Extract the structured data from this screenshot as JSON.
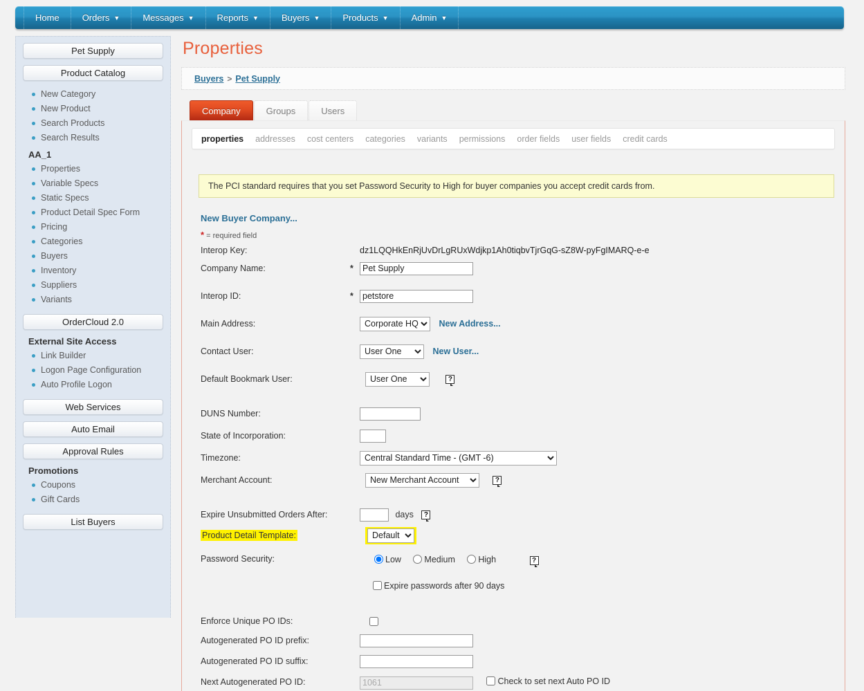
{
  "topnav": {
    "items": [
      {
        "label": "Home",
        "has_caret": false
      },
      {
        "label": "Orders",
        "has_caret": true
      },
      {
        "label": "Messages",
        "has_caret": true
      },
      {
        "label": "Reports",
        "has_caret": true
      },
      {
        "label": "Buyers",
        "has_caret": true
      },
      {
        "label": "Products",
        "has_caret": true
      },
      {
        "label": "Admin",
        "has_caret": true
      }
    ]
  },
  "sidebar": {
    "company_button": "Pet Supply",
    "catalog_button": "Product Catalog",
    "catalog_links": [
      "New Category",
      "New Product",
      "Search Products",
      "Search Results"
    ],
    "aa1_title": "AA_1",
    "aa1_links": [
      "Properties",
      "Variable Specs",
      "Static Specs",
      "Product Detail Spec Form",
      "Pricing",
      "Categories",
      "Buyers",
      "Inventory",
      "Suppliers",
      "Variants"
    ],
    "ordercloud_button": "OrderCloud 2.0",
    "external_title": "External Site Access",
    "external_links": [
      "Link Builder",
      "Logon Page Configuration",
      "Auto Profile Logon"
    ],
    "web_services_button": "Web Services",
    "auto_email_button": "Auto Email",
    "approval_rules_button": "Approval Rules",
    "promotions_title": "Promotions",
    "promotions_links": [
      "Coupons",
      "Gift Cards"
    ],
    "list_buyers_button": "List Buyers"
  },
  "main": {
    "page_title": "Properties",
    "breadcrumb": {
      "root": "Buyers",
      "separator": ">",
      "current": "Pet Supply"
    },
    "tabs": [
      {
        "label": "Company",
        "active": true
      },
      {
        "label": "Groups",
        "active": false
      },
      {
        "label": "Users",
        "active": false
      }
    ],
    "subtabs": [
      {
        "label": "properties",
        "active": true
      },
      {
        "label": "addresses",
        "active": false
      },
      {
        "label": "cost centers",
        "active": false
      },
      {
        "label": "categories",
        "active": false
      },
      {
        "label": "variants",
        "active": false
      },
      {
        "label": "permissions",
        "active": false
      },
      {
        "label": "order fields",
        "active": false
      },
      {
        "label": "user fields",
        "active": false
      },
      {
        "label": "credit cards",
        "active": false
      }
    ],
    "pci_notice": "The PCI standard requires that you set Password Security to High for buyer companies you accept credit cards from.",
    "new_buyer_link": "New Buyer Company...",
    "required_note": "= required field",
    "form": {
      "interop_key_label": "Interop Key:",
      "interop_key_value": "dz1LQQHkEnRjUvDrLgRUxWdjkp1Ah0tiqbvTjrGqG-sZ8W-pyFgIMARQ-e-e",
      "company_name_label": "Company Name:",
      "company_name_value": "Pet Supply",
      "interop_id_label": "Interop ID:",
      "interop_id_value": "petstore",
      "main_address_label": "Main Address:",
      "main_address_value": "Corporate HQ",
      "new_address_link": "New Address...",
      "contact_user_label": "Contact User:",
      "contact_user_value": "User One",
      "new_user_link": "New User...",
      "default_bookmark_user_label": "Default Bookmark User:",
      "default_bookmark_user_value": "User One",
      "duns_label": "DUNS Number:",
      "duns_value": "",
      "state_incorporation_label": "State of Incorporation:",
      "state_incorporation_value": "",
      "timezone_label": "Timezone:",
      "timezone_value": "Central Standard Time - (GMT -6)",
      "merchant_account_label": "Merchant Account:",
      "merchant_account_value": "New Merchant Account",
      "expire_orders_label": "Expire Unsubmitted Orders After:",
      "expire_orders_value": "",
      "expire_orders_unit": "days",
      "product_detail_template_label": "Product Detail Template:",
      "product_detail_template_value": "Default",
      "password_security_label": "Password Security:",
      "password_security_options": [
        "Low",
        "Medium",
        "High"
      ],
      "password_security_selected": "Low",
      "expire_passwords_label": "Expire passwords after 90 days",
      "expire_passwords_checked": false,
      "enforce_unique_po_label": "Enforce Unique PO IDs:",
      "enforce_unique_po_checked": false,
      "po_prefix_label": "Autogenerated PO ID prefix:",
      "po_prefix_value": "",
      "po_suffix_label": "Autogenerated PO ID suffix:",
      "po_suffix_value": "",
      "next_po_label": "Next Autogenerated PO ID:",
      "next_po_value": "1061",
      "next_po_check_label": "Check to set next Auto PO ID",
      "next_po_check_checked": false
    }
  },
  "colors": {
    "nav_blue": "#2b93c4",
    "title_orange": "#e8603c",
    "active_tab_red": "#e04a21",
    "link_blue": "#2b6f96",
    "highlight_yellow": "#fff200",
    "notice_yellow": "#fcfcd2",
    "sidebar_blue": "#dfe7f1"
  }
}
